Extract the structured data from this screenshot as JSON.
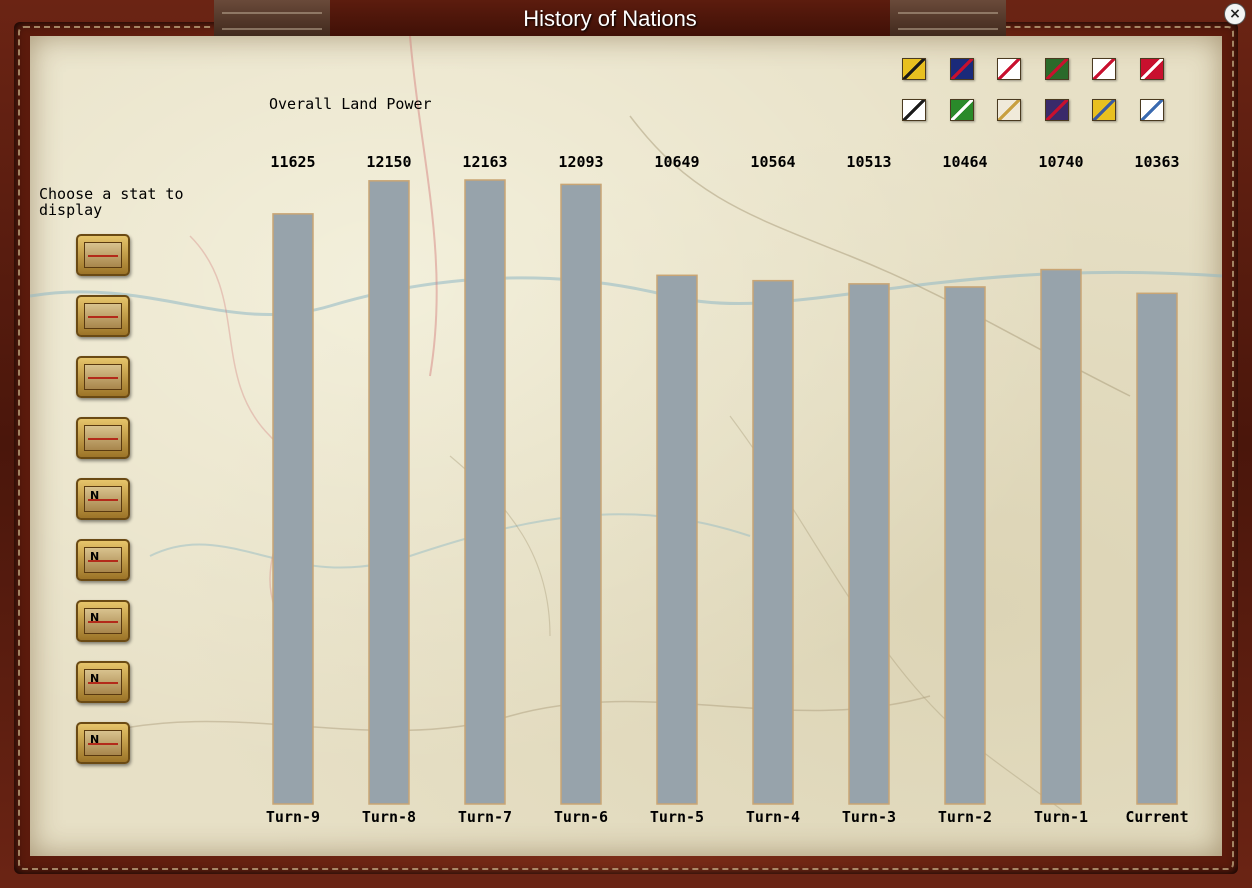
{
  "window": {
    "title": "History of Nations",
    "close_label": "×"
  },
  "sidebar": {
    "prompt": "Choose a stat to display",
    "stat_buttons": [
      {
        "icon": "soldier-icon",
        "n": ""
      },
      {
        "icon": "cannon-icon",
        "n": ""
      },
      {
        "icon": "ship-icon",
        "n": ""
      },
      {
        "icon": "barracks-icon",
        "n": ""
      },
      {
        "icon": "soldier-icon",
        "n": "N"
      },
      {
        "icon": "cavalry-icon",
        "n": "N"
      },
      {
        "icon": "artillery-icon",
        "n": "N"
      },
      {
        "icon": "cavalry-icon",
        "n": "N"
      },
      {
        "icon": "flag-icon",
        "n": "N"
      }
    ]
  },
  "nations": {
    "flags": [
      {
        "icon": "austria-flag-icon",
        "colors": [
          "#e8c020",
          "#1a1a1a"
        ]
      },
      {
        "icon": "britain-flag-icon",
        "colors": [
          "#1a2a7a",
          "#c8102e"
        ]
      },
      {
        "icon": "france-flag-icon",
        "colors": [
          "#ffffff",
          "#c8102e"
        ]
      },
      {
        "icon": "portugal-flag-icon",
        "colors": [
          "#2a6a2a",
          "#c8102e"
        ]
      },
      {
        "icon": "spain-flag-icon",
        "colors": [
          "#ffffff",
          "#c8102e"
        ]
      },
      {
        "icon": "ottoman-flag-icon",
        "colors": [
          "#c8102e",
          "#ffffff"
        ]
      },
      {
        "icon": "prussia-flag-icon",
        "colors": [
          "#ffffff",
          "#1a1a1a"
        ]
      },
      {
        "icon": "egypt-flag-icon",
        "colors": [
          "#2a8a2a",
          "#ffffff"
        ]
      },
      {
        "icon": "papal-flag-icon",
        "colors": [
          "#f0eada",
          "#c8a040"
        ]
      },
      {
        "icon": "russia-flag-icon",
        "colors": [
          "#3a2a6a",
          "#c8102e"
        ]
      },
      {
        "icon": "naples-flag-icon",
        "colors": [
          "#e8c020",
          "#3a5aa0"
        ]
      },
      {
        "icon": "bavaria-flag-icon",
        "colors": [
          "#ffffff",
          "#3a6ab0"
        ]
      }
    ]
  },
  "chart_data": {
    "type": "bar",
    "title": "Overall Land Power",
    "categories": [
      "Turn-9",
      "Turn-8",
      "Turn-7",
      "Turn-6",
      "Turn-5",
      "Turn-4",
      "Turn-3",
      "Turn-2",
      "Turn-1",
      "Current"
    ],
    "values": [
      11625,
      12150,
      12163,
      12093,
      10649,
      10564,
      10513,
      10464,
      10740,
      10363
    ],
    "bar_color": "#97a3ab",
    "bar_edge": "#c9a574",
    "ylim": [
      2250,
      12163
    ]
  }
}
